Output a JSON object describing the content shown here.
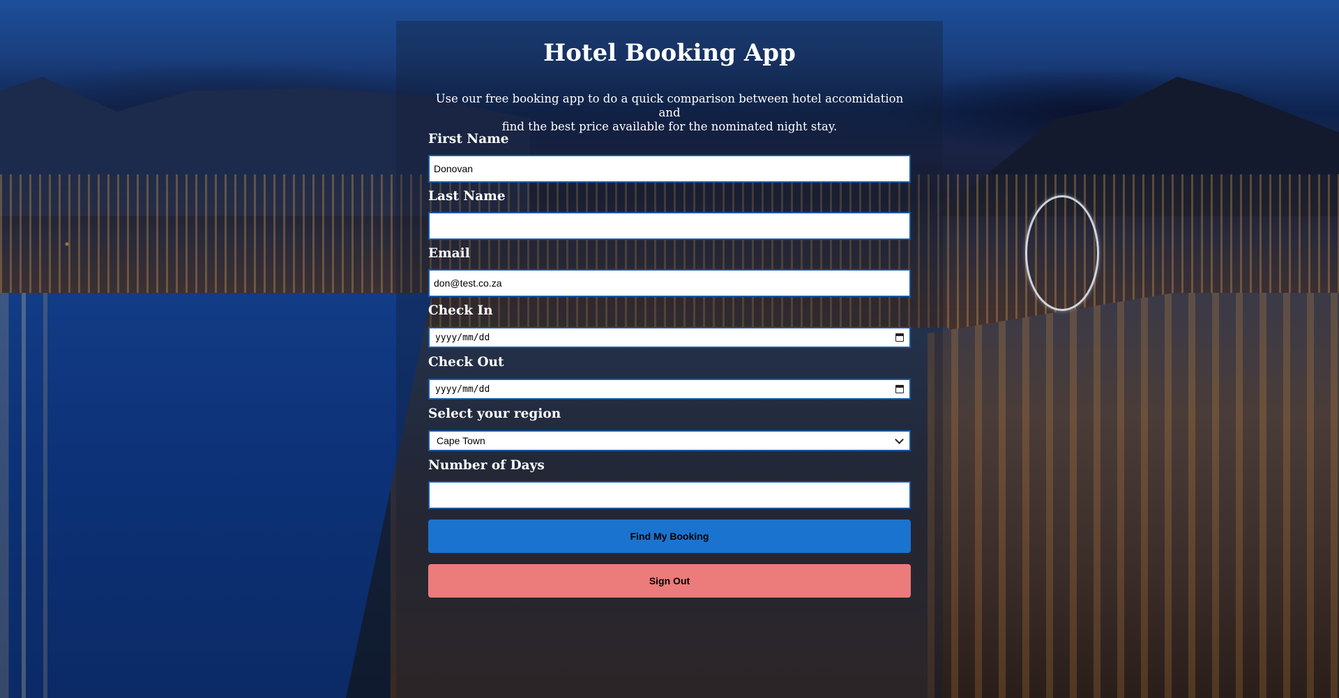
{
  "app": {
    "title": "Hotel Booking App",
    "subtitle_line1": "Use our free booking app to do a quick comparison between hotel accomidation and",
    "subtitle_line2": "find the best price available for the nominated night stay."
  },
  "form": {
    "first_name": {
      "label": "First Name",
      "value": "Donovan",
      "placeholder": ""
    },
    "last_name": {
      "label": "Last Name",
      "value": "",
      "placeholder": ""
    },
    "email": {
      "label": "Email",
      "value": "don@test.co.za",
      "placeholder": ""
    },
    "check_in": {
      "label": "Check In",
      "value": "yyyy/mm/dd"
    },
    "check_out": {
      "label": "Check Out",
      "value": "yyyy/mm/dd"
    },
    "region": {
      "label": "Select your region",
      "selected": "Cape Town"
    },
    "days": {
      "label": "Number of Days",
      "value": "",
      "placeholder": ""
    }
  },
  "buttons": {
    "find": "Find My Booking",
    "sign_out": "Sign Out"
  },
  "colors": {
    "primary_button": "#1a73cf",
    "signout_button": "#ec7b7b",
    "input_border": "#1a5aa8"
  },
  "icons": {
    "calendar": "calendar-icon",
    "dropdown": "chevron-down-icon"
  }
}
